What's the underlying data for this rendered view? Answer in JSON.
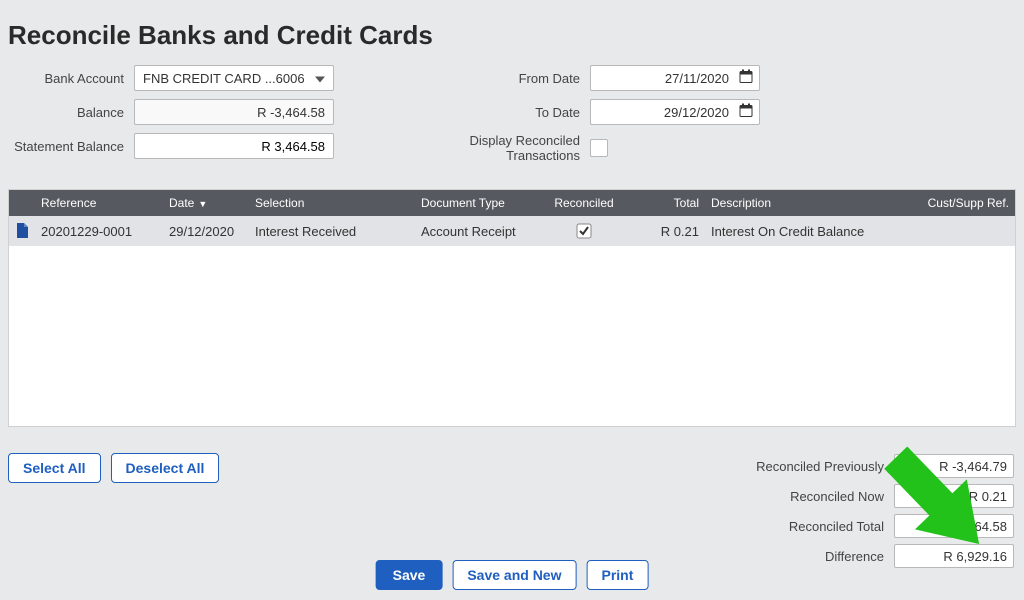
{
  "title": "Reconcile Banks and Credit Cards",
  "filters": {
    "bank_account_label": "Bank Account",
    "bank_account_value": "FNB CREDIT CARD ...6006",
    "balance_label": "Balance",
    "balance_value": "R -3,464.58",
    "statement_balance_label": "Statement Balance",
    "statement_balance_value": "R 3,464.58",
    "from_date_label": "From Date",
    "from_date_value": "27/11/2020",
    "to_date_label": "To Date",
    "to_date_value": "29/12/2020",
    "display_reconciled_label": "Display Reconciled Transactions"
  },
  "grid": {
    "headers": {
      "reference": "Reference",
      "date": "Date",
      "selection": "Selection",
      "doc_type": "Document Type",
      "reconciled": "Reconciled",
      "total": "Total",
      "description": "Description",
      "cust_supp": "Cust/Supp Ref."
    },
    "rows": [
      {
        "reference": "20201229-0001",
        "date": "29/12/2020",
        "selection": "Interest Received",
        "doc_type": "Account Receipt",
        "reconciled": true,
        "total": "R 0.21",
        "description": "Interest On Credit Balance",
        "cust_supp": ""
      }
    ]
  },
  "buttons": {
    "select_all": "Select All",
    "deselect_all": "Deselect All",
    "save": "Save",
    "save_new": "Save and New",
    "print": "Print"
  },
  "summary": {
    "reconciled_prev_label": "Reconciled Previously",
    "reconciled_prev_value": "R -3,464.79",
    "reconciled_now_label": "Reconciled Now",
    "reconciled_now_value": "R 0.21",
    "reconciled_total_label": "Reconciled Total",
    "reconciled_total_value": "R -3,464.58",
    "difference_label": "Difference",
    "difference_value": "R 6,929.16"
  },
  "colors": {
    "accent": "#1f5fbf",
    "arrow": "#22c21a"
  }
}
